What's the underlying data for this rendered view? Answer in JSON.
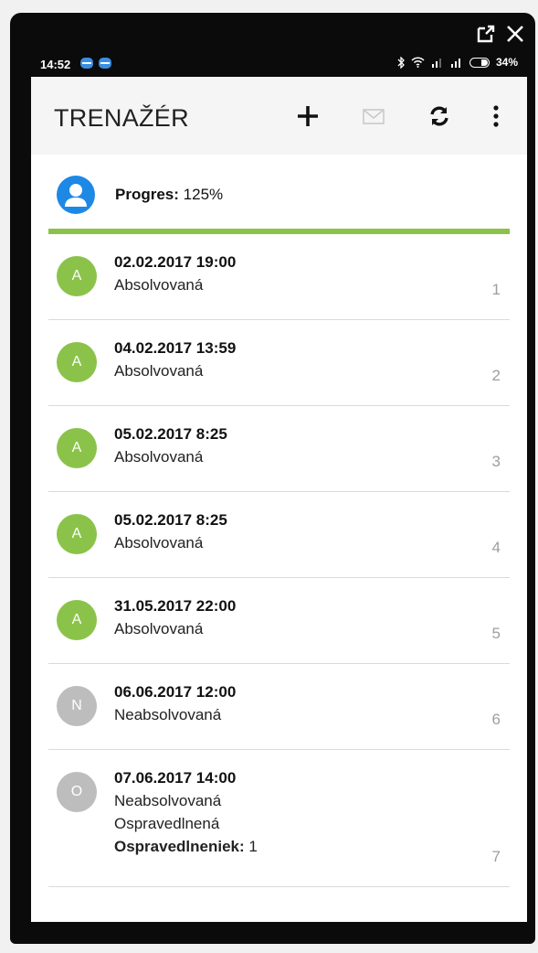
{
  "status_bar": {
    "time": "14:52",
    "battery": "34%"
  },
  "app_bar": {
    "title": "TRENAŽÉR",
    "icons": [
      "add-icon",
      "mail-icon",
      "refresh-icon",
      "more-vert-icon"
    ]
  },
  "progress": {
    "label": "Progres:",
    "value": "125%",
    "fill_fraction": 1.0,
    "bar_color": "#8bc34a"
  },
  "colors": {
    "absolved": "#8bc34a",
    "not_absolved": "#bdbdbd",
    "accent_blue": "#1e88e5"
  },
  "items": [
    {
      "initial": "A",
      "date": "02.02.2017 19:00",
      "status": "Absolvovaná",
      "index": "1"
    },
    {
      "initial": "A",
      "date": "04.02.2017 13:59",
      "status": "Absolvovaná",
      "index": "2"
    },
    {
      "initial": "A",
      "date": "05.02.2017 8:25",
      "status": "Absolvovaná",
      "index": "3"
    },
    {
      "initial": "A",
      "date": "05.02.2017 8:25",
      "status": "Absolvovaná",
      "index": "4"
    },
    {
      "initial": "A",
      "date": "31.05.2017 22:00",
      "status": "Absolvovaná",
      "index": "5"
    },
    {
      "initial": "N",
      "date": "06.06.2017 12:00",
      "status": "Neabsolvovaná",
      "index": "6"
    },
    {
      "initial": "O",
      "date": "07.06.2017 14:00",
      "status": "Neabsolvovaná",
      "excuse": "Ospravedlnená",
      "excuse_label": "Ospravedlneniek:",
      "excuse_count": "1",
      "index": "7"
    }
  ]
}
